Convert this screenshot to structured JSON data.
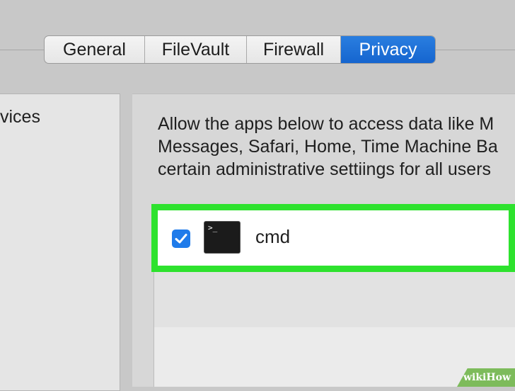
{
  "tabs": [
    {
      "label": "General",
      "selected": false
    },
    {
      "label": "FileVault",
      "selected": false
    },
    {
      "label": "Firewall",
      "selected": false
    },
    {
      "label": "Privacy",
      "selected": true
    }
  ],
  "sidebar": {
    "items": [
      {
        "label": "vices"
      }
    ]
  },
  "main": {
    "description_lines": [
      "Allow the apps below to access data like M",
      "Messages, Safari, Home, Time Machine Ba",
      "certain administrative settiings for all users"
    ],
    "apps": [
      {
        "name": "cmd",
        "checked": true,
        "icon": "terminal-icon",
        "icon_text": ">_"
      }
    ]
  },
  "watermark": {
    "prefix": "wiki",
    "suffix": "How"
  },
  "colors": {
    "accent": "#1565cf",
    "checkbox": "#1f7bea",
    "highlight": "#2ee22e"
  }
}
